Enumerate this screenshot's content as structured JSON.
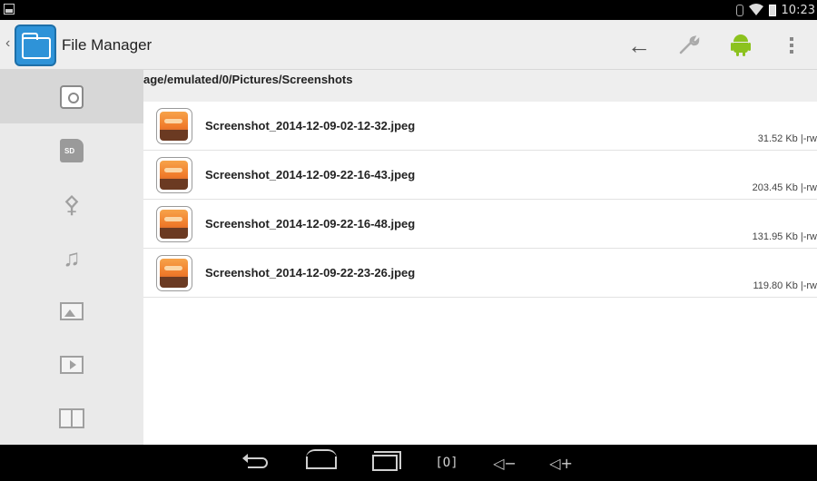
{
  "status_bar": {
    "time": "10:23",
    "icons": [
      "notification-icon",
      "bluetooth-icon",
      "wifi-icon",
      "battery-icon"
    ]
  },
  "action_bar": {
    "app_title": "File Manager",
    "app_icon": "file-manager-app-icon",
    "actions": [
      {
        "name": "back-arrow-icon",
        "glyph": "←"
      },
      {
        "name": "wrench-icon",
        "glyph": "🔧"
      },
      {
        "name": "android-icon"
      },
      {
        "name": "overflow-menu-icon"
      }
    ]
  },
  "sidebar": {
    "items": [
      {
        "name": "internal-storage-icon",
        "active": true
      },
      {
        "name": "sd-card-icon",
        "label": "SD"
      },
      {
        "name": "usb-icon",
        "glyph": "⚴"
      },
      {
        "name": "music-icon",
        "glyph": "♫"
      },
      {
        "name": "image-icon"
      },
      {
        "name": "video-icon"
      },
      {
        "name": "book-icon"
      }
    ]
  },
  "path": {
    "current": "age/emulated/0/Pictures/Screenshots"
  },
  "files": [
    {
      "name": "Screenshot_2014-12-09-02-12-32.jpeg",
      "meta": "31.52 Kb |-rw"
    },
    {
      "name": "Screenshot_2014-12-09-22-16-43.jpeg",
      "meta": "203.45 Kb |-rw"
    },
    {
      "name": "Screenshot_2014-12-09-22-16-48.jpeg",
      "meta": "131.95 Kb |-rw"
    },
    {
      "name": "Screenshot_2014-12-09-22-23-26.jpeg",
      "meta": "119.80 Kb |-rw"
    }
  ],
  "nav_bar": {
    "screenshot_glyph": "[O]",
    "vol_down_glyph": "◁−",
    "vol_up_glyph": "◁+"
  },
  "colors": {
    "action_bar_bg": "#eeeeee",
    "sidebar_bg": "#eaeaea",
    "sidebar_active": "#d7d7d7",
    "android_green": "#8cc21e",
    "app_icon_blue": "#2e93d8"
  }
}
